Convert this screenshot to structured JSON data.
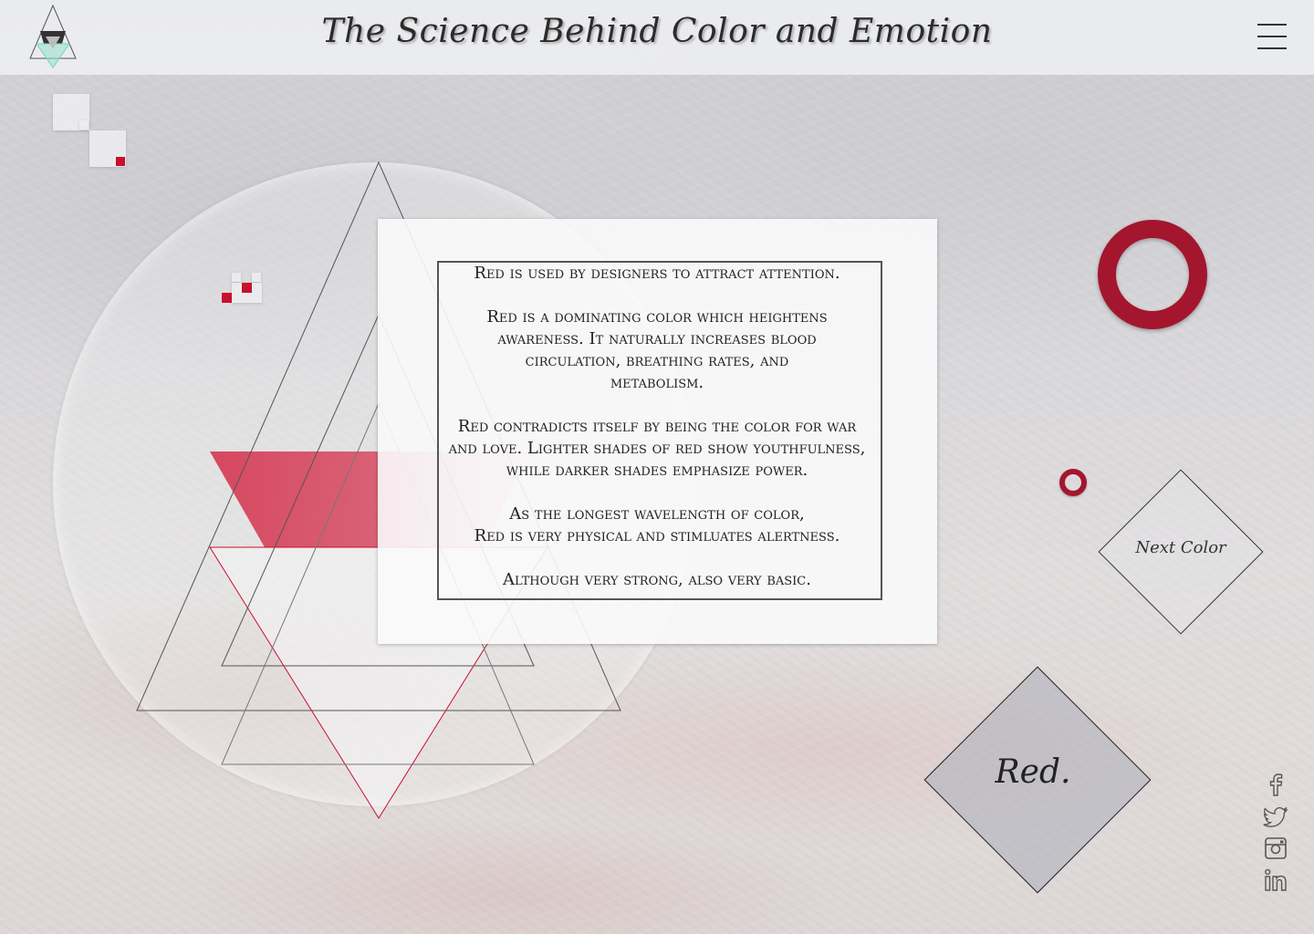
{
  "header": {
    "title": "The Science Behind Color and Emotion",
    "logo": "triangle-logo-icon",
    "menu": "hamburger-menu-icon"
  },
  "content": {
    "paragraphs": [
      "Red is used by designers to attract attention.",
      "Red is a dominating color which heightens\nawareness. It naturally increases blood\ncirculation, breathing rates, and\nmetabolism.",
      "Red contradicts itself by being the color for war\nand love. Lighter shades of red show youthfulness,\nwhile darker shades emphasize power.",
      "As the longest wavelength of color,\nRed is very physical and stimluates alertness.",
      "Although very strong, also very basic."
    ]
  },
  "navigation": {
    "next_label": "Next Color",
    "current_label": "Red."
  },
  "social": [
    {
      "name": "facebook-icon"
    },
    {
      "name": "twitter-icon"
    },
    {
      "name": "instagram-icon"
    },
    {
      "name": "linkedin-icon"
    }
  ],
  "colors": {
    "accent_red": "#c8102e",
    "ring_red": "#a3162e",
    "line_gray": "#666666",
    "text_dark": "#222222"
  }
}
